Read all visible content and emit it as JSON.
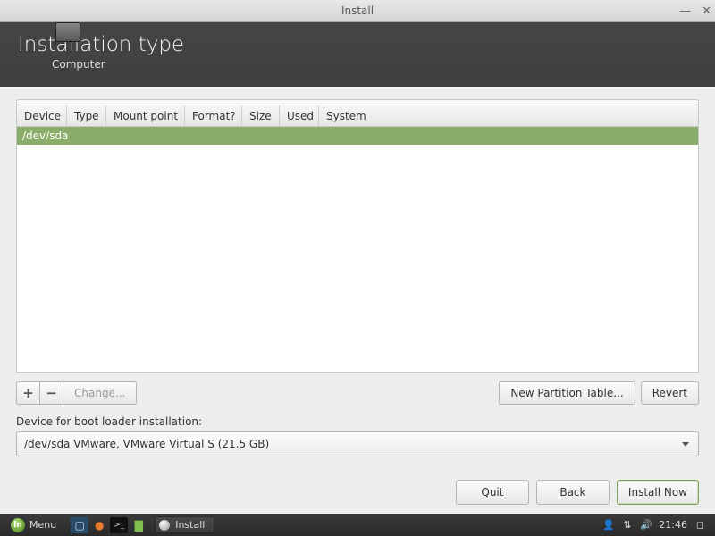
{
  "window": {
    "title": "Install"
  },
  "header": {
    "title": "Installation type",
    "breadcrumb": "Computer"
  },
  "table": {
    "columns": [
      "Device",
      "Type",
      "Mount point",
      "Format?",
      "Size",
      "Used",
      "System"
    ],
    "rows": [
      {
        "device": "/dev/sda"
      }
    ]
  },
  "toolbar": {
    "add": "+",
    "remove": "−",
    "change": "Change...",
    "new_table": "New Partition Table...",
    "revert": "Revert"
  },
  "bootloader": {
    "label": "Device for boot loader installation:",
    "selected": "/dev/sda VMware, VMware Virtual S (21.5 GB)"
  },
  "footer": {
    "quit": "Quit",
    "back": "Back",
    "install": "Install Now"
  },
  "taskbar": {
    "menu": "Menu",
    "active_task": "Install",
    "clock": "21:46"
  }
}
